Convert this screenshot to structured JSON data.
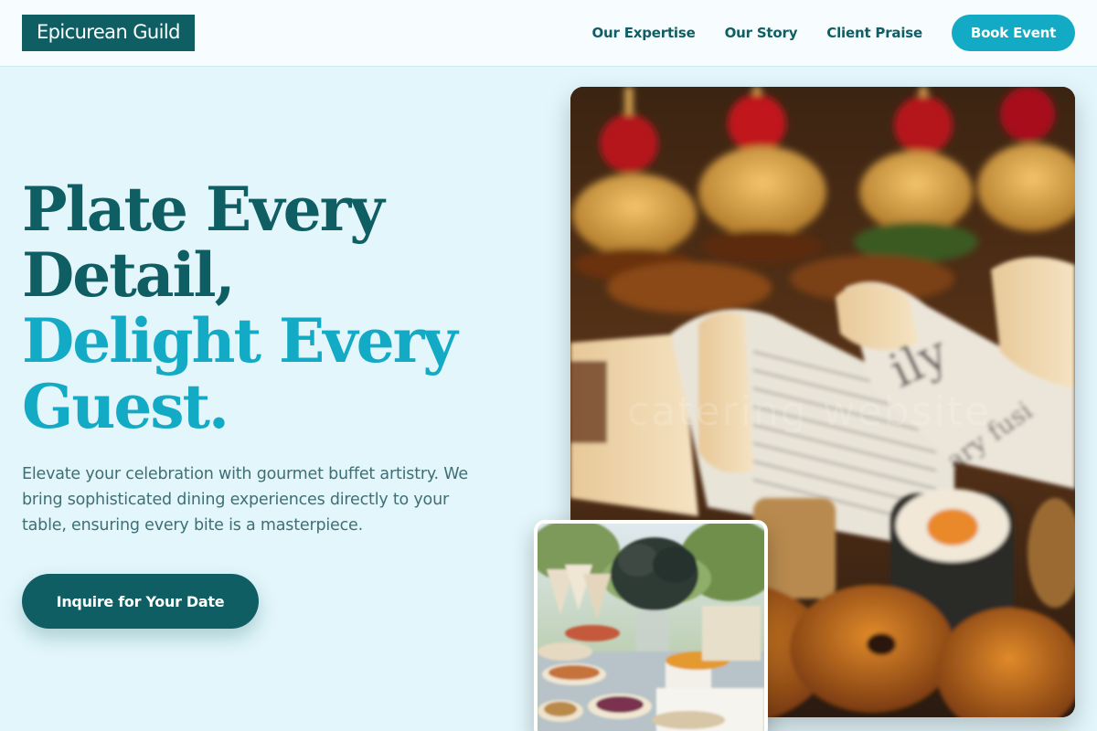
{
  "header": {
    "logo": "Epicurean Guild",
    "nav": [
      "Our Expertise",
      "Our Story",
      "Client Praise"
    ],
    "book_button": "Book Event"
  },
  "hero": {
    "headline_line1": "Plate Every",
    "headline_line2": "Detail,",
    "headline_line3": "Delight Every",
    "headline_line4": "Guest.",
    "description": "Elevate your celebration with gourmet buffet artistry. We bring sophisticated dining experiences directly to your table, ensuring every bite is a masterpiece.",
    "cta_button": "Inquire for Your Date"
  },
  "images": {
    "main_alt": "Gourmet finger food: mini burgers, wraps in newspaper and pastries",
    "main_watermark": "catering website",
    "secondary_alt": "Outdoor buffet table with appetizers and floral centerpiece"
  },
  "colors": {
    "primary": "#0f5e63",
    "accent": "#12aac4",
    "background": "#e2f6fb",
    "header_bg": "#f7fdff"
  }
}
